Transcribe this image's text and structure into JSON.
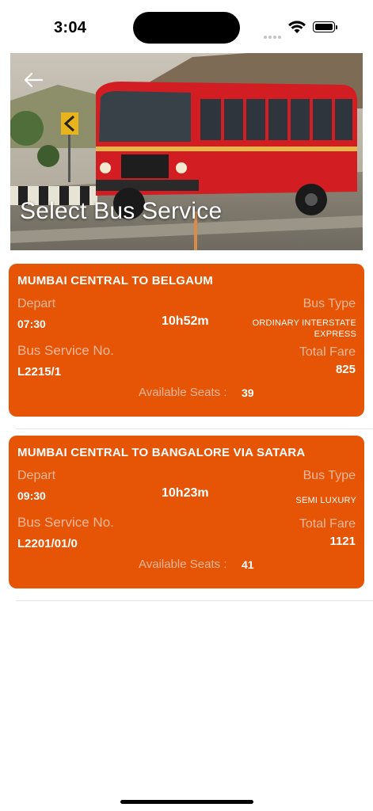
{
  "status_bar": {
    "time": "3:04"
  },
  "header": {
    "title": "Select Bus Service",
    "back_icon": "arrow-left-icon"
  },
  "labels": {
    "depart": "Depart",
    "bus_type": "Bus Type",
    "service_no": "Bus Service No.",
    "total_fare": "Total Fare",
    "available_seats": "Available Seats :"
  },
  "services": [
    {
      "route": "MUMBAI CENTRAL TO BELGAUM",
      "depart_time": "07:30",
      "duration": "10h52m",
      "bus_type_line1": "ORDINARY INTERSTATE",
      "bus_type_line2": "EXPRESS",
      "service_no": "L2215/1",
      "fare": "825",
      "seats": "39"
    },
    {
      "route": "MUMBAI CENTRAL TO BANGALORE VIA SATARA",
      "depart_time": "09:30",
      "duration": "10h23m",
      "bus_type_line1": "SEMI LUXURY",
      "bus_type_line2": "",
      "service_no": "L2201/01/0",
      "fare": "1121",
      "seats": "41"
    }
  ],
  "colors": {
    "card": "#e65406",
    "label": "#f3b89b"
  }
}
